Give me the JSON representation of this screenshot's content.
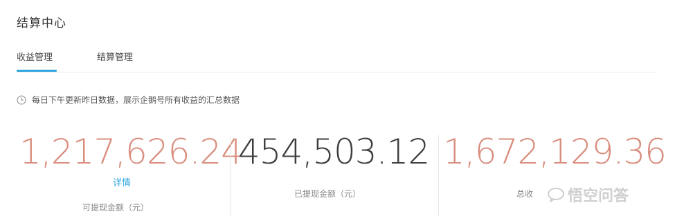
{
  "page": {
    "title": "结算中心"
  },
  "tabs": [
    {
      "label": "收益管理",
      "active": true
    },
    {
      "label": "结算管理",
      "active": false
    }
  ],
  "notice": {
    "icon": "clock-icon",
    "text": "每日下午更新昨日数据，展示企鹅号所有收益的汇总数据"
  },
  "stats": [
    {
      "value": "1,217,626.24",
      "label": "可提现金额（元）",
      "link": "详情",
      "color": "#d98e7e"
    },
    {
      "value": "454,503.12",
      "label": "已提现金额（元）",
      "color": "#3e3e3e"
    },
    {
      "value": "1,672,129.36",
      "label": "总收",
      "color": "#d98e7e"
    }
  ],
  "colors": {
    "accent": "#2fa6e0"
  },
  "watermark": {
    "text": "悟空问答"
  }
}
